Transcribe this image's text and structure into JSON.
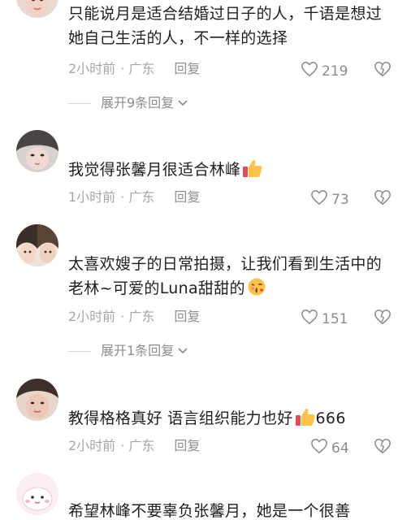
{
  "comments": [
    {
      "text": "只能说月是适合结婚过日子的人，千语是想过她自己生活的人，不一样的选择",
      "time": "2小时前",
      "location": "· 广东",
      "reply": "回复",
      "likes": "219",
      "expand": "展开9条回复"
    },
    {
      "text": "我觉得张馨月很适合林峰",
      "emoji": "thumbs-up",
      "time": "1小时前",
      "location": "· 广东",
      "reply": "回复",
      "likes": "73"
    },
    {
      "text": "太喜欢嫂子的日常拍摄，让我们看到生活中的老林~可爱的Luna甜甜的",
      "emoji": "kissing-face",
      "time": "2小时前",
      "location": "· 广东",
      "reply": "回复",
      "likes": "151",
      "expand": "展开1条回复"
    },
    {
      "text": "教得格格真好 语言组织能力也好",
      "emoji": "thumbs-up",
      "text_after_emoji": "666",
      "time": "2小时前",
      "location": "· 广东",
      "reply": "回复",
      "likes": "64"
    },
    {
      "text": "希望林峰不要辜负张馨月，她是一个很善"
    }
  ],
  "icons": {
    "like": "heart-outline-icon",
    "dislike": "broken-heart-outline-icon",
    "expand": "chevron-down-icon"
  }
}
